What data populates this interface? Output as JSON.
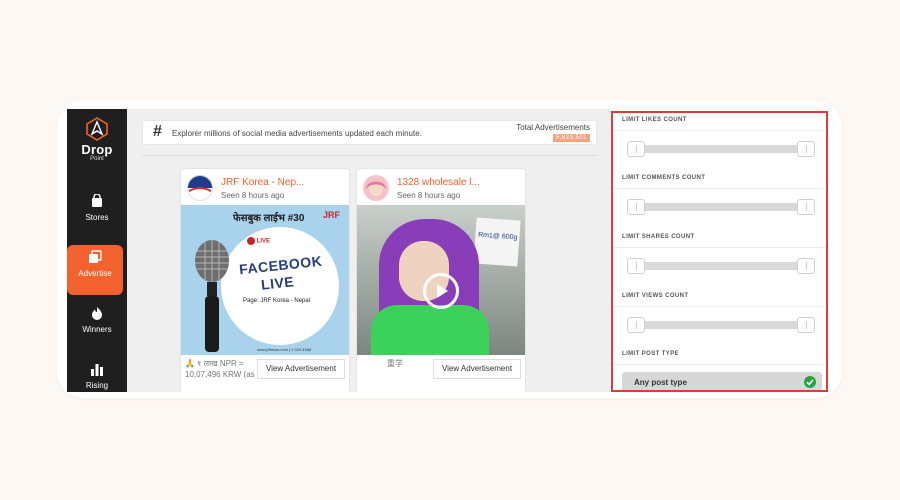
{
  "sidebar": {
    "logo": {
      "word": "Drop",
      "sub": "Point"
    },
    "items": [
      {
        "label": "Stores",
        "icon": "shopping-bag-icon"
      },
      {
        "label": "Advertise",
        "icon": "layers-icon",
        "active": true
      },
      {
        "label": "Winners",
        "icon": "flame-icon"
      },
      {
        "label": "Rising",
        "icon": "bar-chart-icon"
      }
    ],
    "accent": "#f2622e"
  },
  "banner": {
    "text": "Explorer millions of social media advertisements updated each minute.",
    "total_label": "Total Advertisements",
    "total_value": "5,623,501"
  },
  "cards": [
    {
      "name": "JRF Korea - Nep...",
      "seen": "Seen 8 hours ago",
      "caption": "🙏 १ लाख NPR = 10,07,496 KRW (as",
      "button": "View Advertisement",
      "media": {
        "headline": "फेसबुक लाईभ #30",
        "brand": "JRF",
        "live_tag": "LIVE",
        "title_line1": "FACEBOOK",
        "title_line2": "LIVE",
        "page_line": "Page: JRF Korea - Nepal",
        "footer": "www.jrfnews.com  |  1 023 4588"
      }
    },
    {
      "name": "1328 wholesale l...",
      "seen": "Seen 8 hours ago",
      "caption": "重学",
      "button": "View Advertisement",
      "media": {
        "price_note": "Rm1@ 600g"
      }
    }
  ],
  "filters": {
    "likes_label": "LIMIT LIKES COUNT",
    "comments_label": "LIMIT COMMENTS COUNT",
    "shares_label": "LIMIT SHARES COUNT",
    "views_label": "LIMIT VIEWS COUNT",
    "post_type_label": "LIMIT POST TYPE",
    "post_type_value": "Any post type",
    "border_color": "#e53935"
  }
}
